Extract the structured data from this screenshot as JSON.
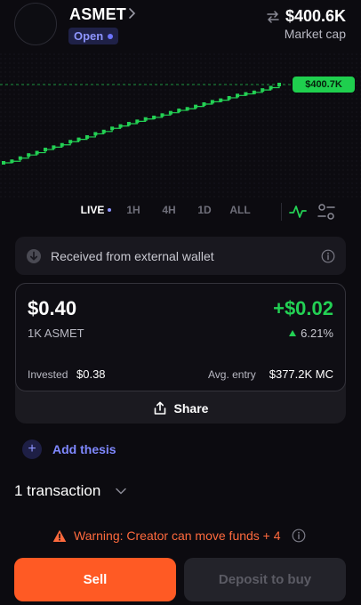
{
  "header": {
    "token_name": "ASMET",
    "status": "Open",
    "market_cap_value": "$400.6K",
    "market_cap_label": "Market cap"
  },
  "chart_data": {
    "type": "line",
    "reference_label": "$400.7K",
    "x": [
      0,
      1,
      2,
      3,
      4,
      5,
      6,
      7,
      8,
      9,
      10,
      11,
      12,
      13,
      14,
      15,
      16,
      17,
      18,
      19,
      20,
      21,
      22,
      23,
      24,
      25,
      26,
      27,
      28,
      29,
      30,
      31,
      32,
      33
    ],
    "values": [
      0.0,
      0.02,
      0.06,
      0.1,
      0.13,
      0.17,
      0.2,
      0.23,
      0.27,
      0.3,
      0.33,
      0.37,
      0.4,
      0.44,
      0.47,
      0.5,
      0.53,
      0.56,
      0.58,
      0.61,
      0.64,
      0.67,
      0.69,
      0.72,
      0.75,
      0.78,
      0.8,
      0.83,
      0.86,
      0.88,
      0.9,
      0.93,
      0.96,
      1.0
    ],
    "colors": {
      "line": "#23d154",
      "reference": "#23d154"
    }
  },
  "timeframes": {
    "items": [
      "LIVE",
      "1H",
      "4H",
      "1D",
      "ALL"
    ],
    "active": "LIVE"
  },
  "received": {
    "text": "Received from external wallet"
  },
  "position": {
    "price": "$0.40",
    "pnl": "+$0.02",
    "holding": "1K ASMET",
    "pct_change": "6.21%",
    "invested_label": "Invested",
    "invested_value": "$0.38",
    "avg_entry_label": "Avg. entry",
    "avg_entry_value": "$377.2K MC",
    "share_label": "Share"
  },
  "thesis": {
    "label": "Add thesis"
  },
  "transactions": {
    "label": "1 transaction"
  },
  "warning": {
    "text": "Warning: Creator can move funds + 4"
  },
  "actions": {
    "sell_label": "Sell",
    "deposit_label": "Deposit to buy"
  },
  "colors": {
    "accent_green": "#23d154",
    "accent_orange": "#ff5a24",
    "accent_purple": "#8e95ff",
    "background": "#0c0b10"
  },
  "icons": [
    "chevron-right-icon",
    "swap-icon",
    "pulse-icon",
    "toggle-icon",
    "arrow-down-circle-icon",
    "info-icon",
    "share-icon",
    "plus-icon",
    "chevron-down-icon",
    "warning-icon"
  ]
}
